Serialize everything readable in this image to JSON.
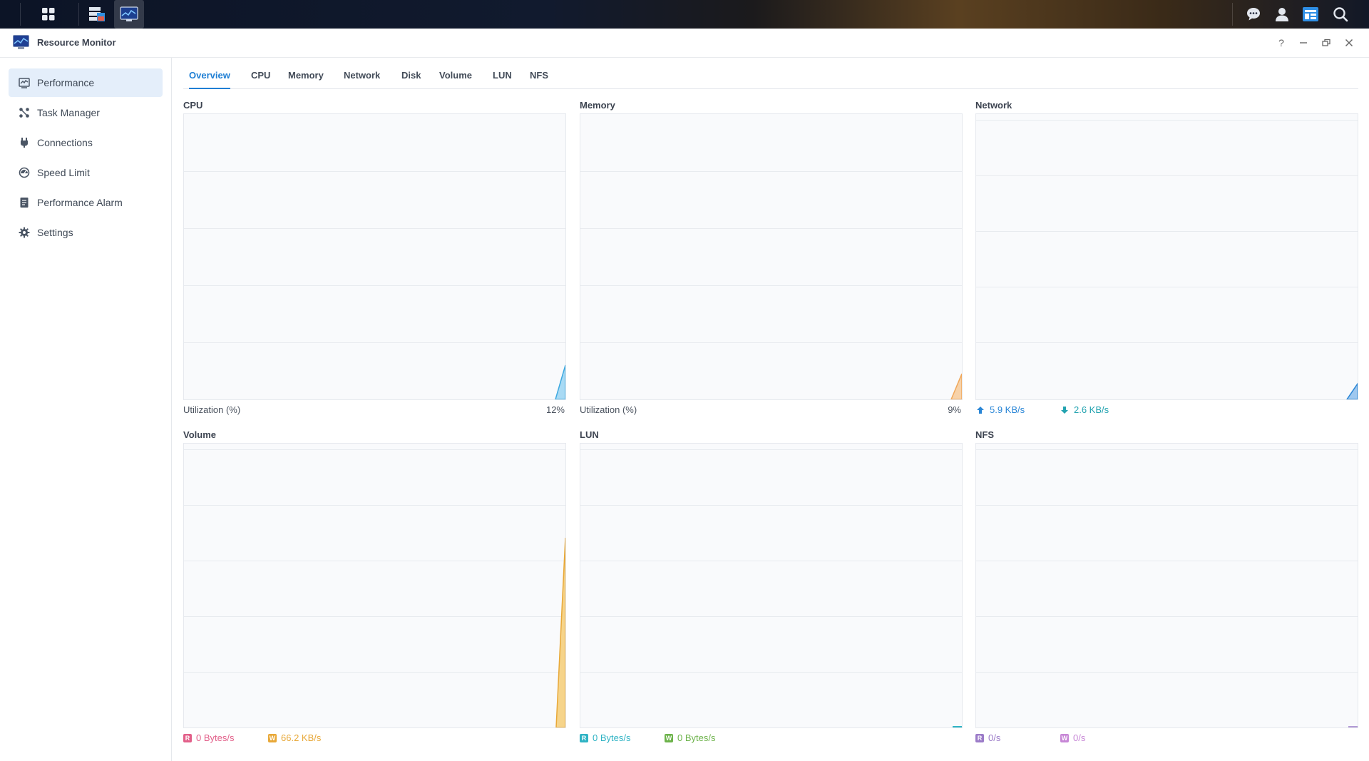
{
  "taskbar": {
    "left_icons": [
      "main-menu-icon",
      "storage-manager-icon",
      "resource-monitor-icon"
    ],
    "right_icons": [
      "chat-icon",
      "user-icon",
      "widgets-icon",
      "search-icon"
    ]
  },
  "window": {
    "title": "Resource Monitor",
    "controls": [
      "help-icon",
      "minimize-icon",
      "restore-icon",
      "close-icon"
    ],
    "help_glyph": "?"
  },
  "sidebar": {
    "items": [
      {
        "label": "Performance",
        "icon": "performance-icon",
        "active": true
      },
      {
        "label": "Task Manager",
        "icon": "task-manager-icon",
        "active": false
      },
      {
        "label": "Connections",
        "icon": "plug-icon",
        "active": false
      },
      {
        "label": "Speed Limit",
        "icon": "speed-icon",
        "active": false
      },
      {
        "label": "Performance Alarm",
        "icon": "alarm-icon",
        "active": false
      },
      {
        "label": "Settings",
        "icon": "gear-icon",
        "active": false
      }
    ]
  },
  "tabs": [
    "Overview",
    "CPU",
    "Memory",
    "Network",
    "Disk",
    "Volume",
    "LUN",
    "NFS"
  ],
  "active_tab": "Overview",
  "panels": {
    "cpu": {
      "title": "CPU",
      "legend": "Utilization  (%)",
      "value": "12%"
    },
    "memory": {
      "title": "Memory",
      "legend": "Utilization  (%)",
      "value": "9%"
    },
    "network": {
      "title": "Network",
      "upload": "5.9 KB/s",
      "download": "2.6 KB/s"
    },
    "volume": {
      "title": "Volume",
      "read_letter": "R",
      "read": "0 Bytes/s",
      "write_letter": "W",
      "write": "66.2 KB/s"
    },
    "lun": {
      "title": "LUN",
      "read_letter": "R",
      "read": "0 Bytes/s",
      "write_letter": "W",
      "write": "0 Bytes/s"
    },
    "nfs": {
      "title": "NFS",
      "read_letter": "R",
      "read": "0/s",
      "write_letter": "W",
      "write": "0/s"
    }
  },
  "colors": {
    "accent": "#1f7fd4",
    "cpu": "#3ea9e0",
    "memory": "#f0a75a",
    "network": "#2a86d6",
    "volume_read": "#e2608a",
    "volume_write": "#e8a838",
    "lun_read": "#2fb3c4",
    "lun_write": "#6db34b",
    "nfs_read": "#9b7bc8",
    "nfs_write": "#c787d6"
  },
  "chart_data": [
    {
      "type": "area",
      "title": "CPU",
      "ylabel": "Utilization (%)",
      "latest": 12,
      "ylim": [
        0,
        100
      ]
    },
    {
      "type": "area",
      "title": "Memory",
      "ylabel": "Utilization (%)",
      "latest": 9,
      "ylim": [
        0,
        100
      ]
    },
    {
      "type": "area",
      "title": "Network",
      "series": [
        {
          "name": "upload",
          "latest": "5.9 KB/s"
        },
        {
          "name": "download",
          "latest": "2.6 KB/s"
        }
      ]
    },
    {
      "type": "area",
      "title": "Volume",
      "series": [
        {
          "name": "R",
          "latest": "0 Bytes/s"
        },
        {
          "name": "W",
          "latest": "66.2 KB/s"
        }
      ]
    },
    {
      "type": "area",
      "title": "LUN",
      "series": [
        {
          "name": "R",
          "latest": "0 Bytes/s"
        },
        {
          "name": "W",
          "latest": "0 Bytes/s"
        }
      ]
    },
    {
      "type": "area",
      "title": "NFS",
      "series": [
        {
          "name": "R",
          "latest": "0/s"
        },
        {
          "name": "W",
          "latest": "0/s"
        }
      ]
    }
  ]
}
